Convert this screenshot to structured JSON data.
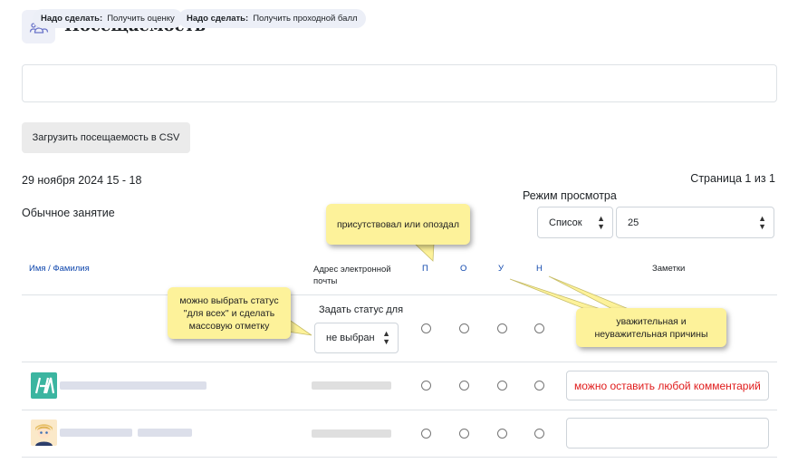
{
  "page": {
    "title": "Посещаемость",
    "icon": "users-icon"
  },
  "todo": [
    {
      "label": "Надо сделать:",
      "value": "Получить оценку"
    },
    {
      "label": "Надо сделать:",
      "value": "Получить проходной балл"
    }
  ],
  "csv_button": "Загрузить посещаемость в CSV",
  "session": {
    "date": "29 ноября 2024 15 - 18",
    "type": "Обычное занятие"
  },
  "pager": "Страница 1 из 1",
  "view_mode": {
    "label": "Режим просмотра",
    "type_value": "Список",
    "count_value": "25"
  },
  "table": {
    "headers": {
      "name": "Имя / Фамилия",
      "email": "Адрес электронной почты",
      "status": [
        "П",
        "О",
        "У",
        "Н"
      ],
      "notes": "Заметки"
    },
    "set_status": {
      "label": "Задать статус для",
      "value": "не выбран"
    },
    "rows": [
      {
        "note_value": "можно оставить любой комментарий"
      },
      {
        "note_value": ""
      }
    ]
  },
  "callouts": {
    "present_late": "присутствовал или опоздал",
    "mass_mark": "можно выбрать статус \"для всех\" и сделать массовую отметку",
    "reason": "уважительная и неуважительная причины"
  },
  "colors": {
    "link": "#0f47ad",
    "callout": "#fdf29a",
    "note_text": "#e01b1b",
    "pill": "#eceff7"
  }
}
